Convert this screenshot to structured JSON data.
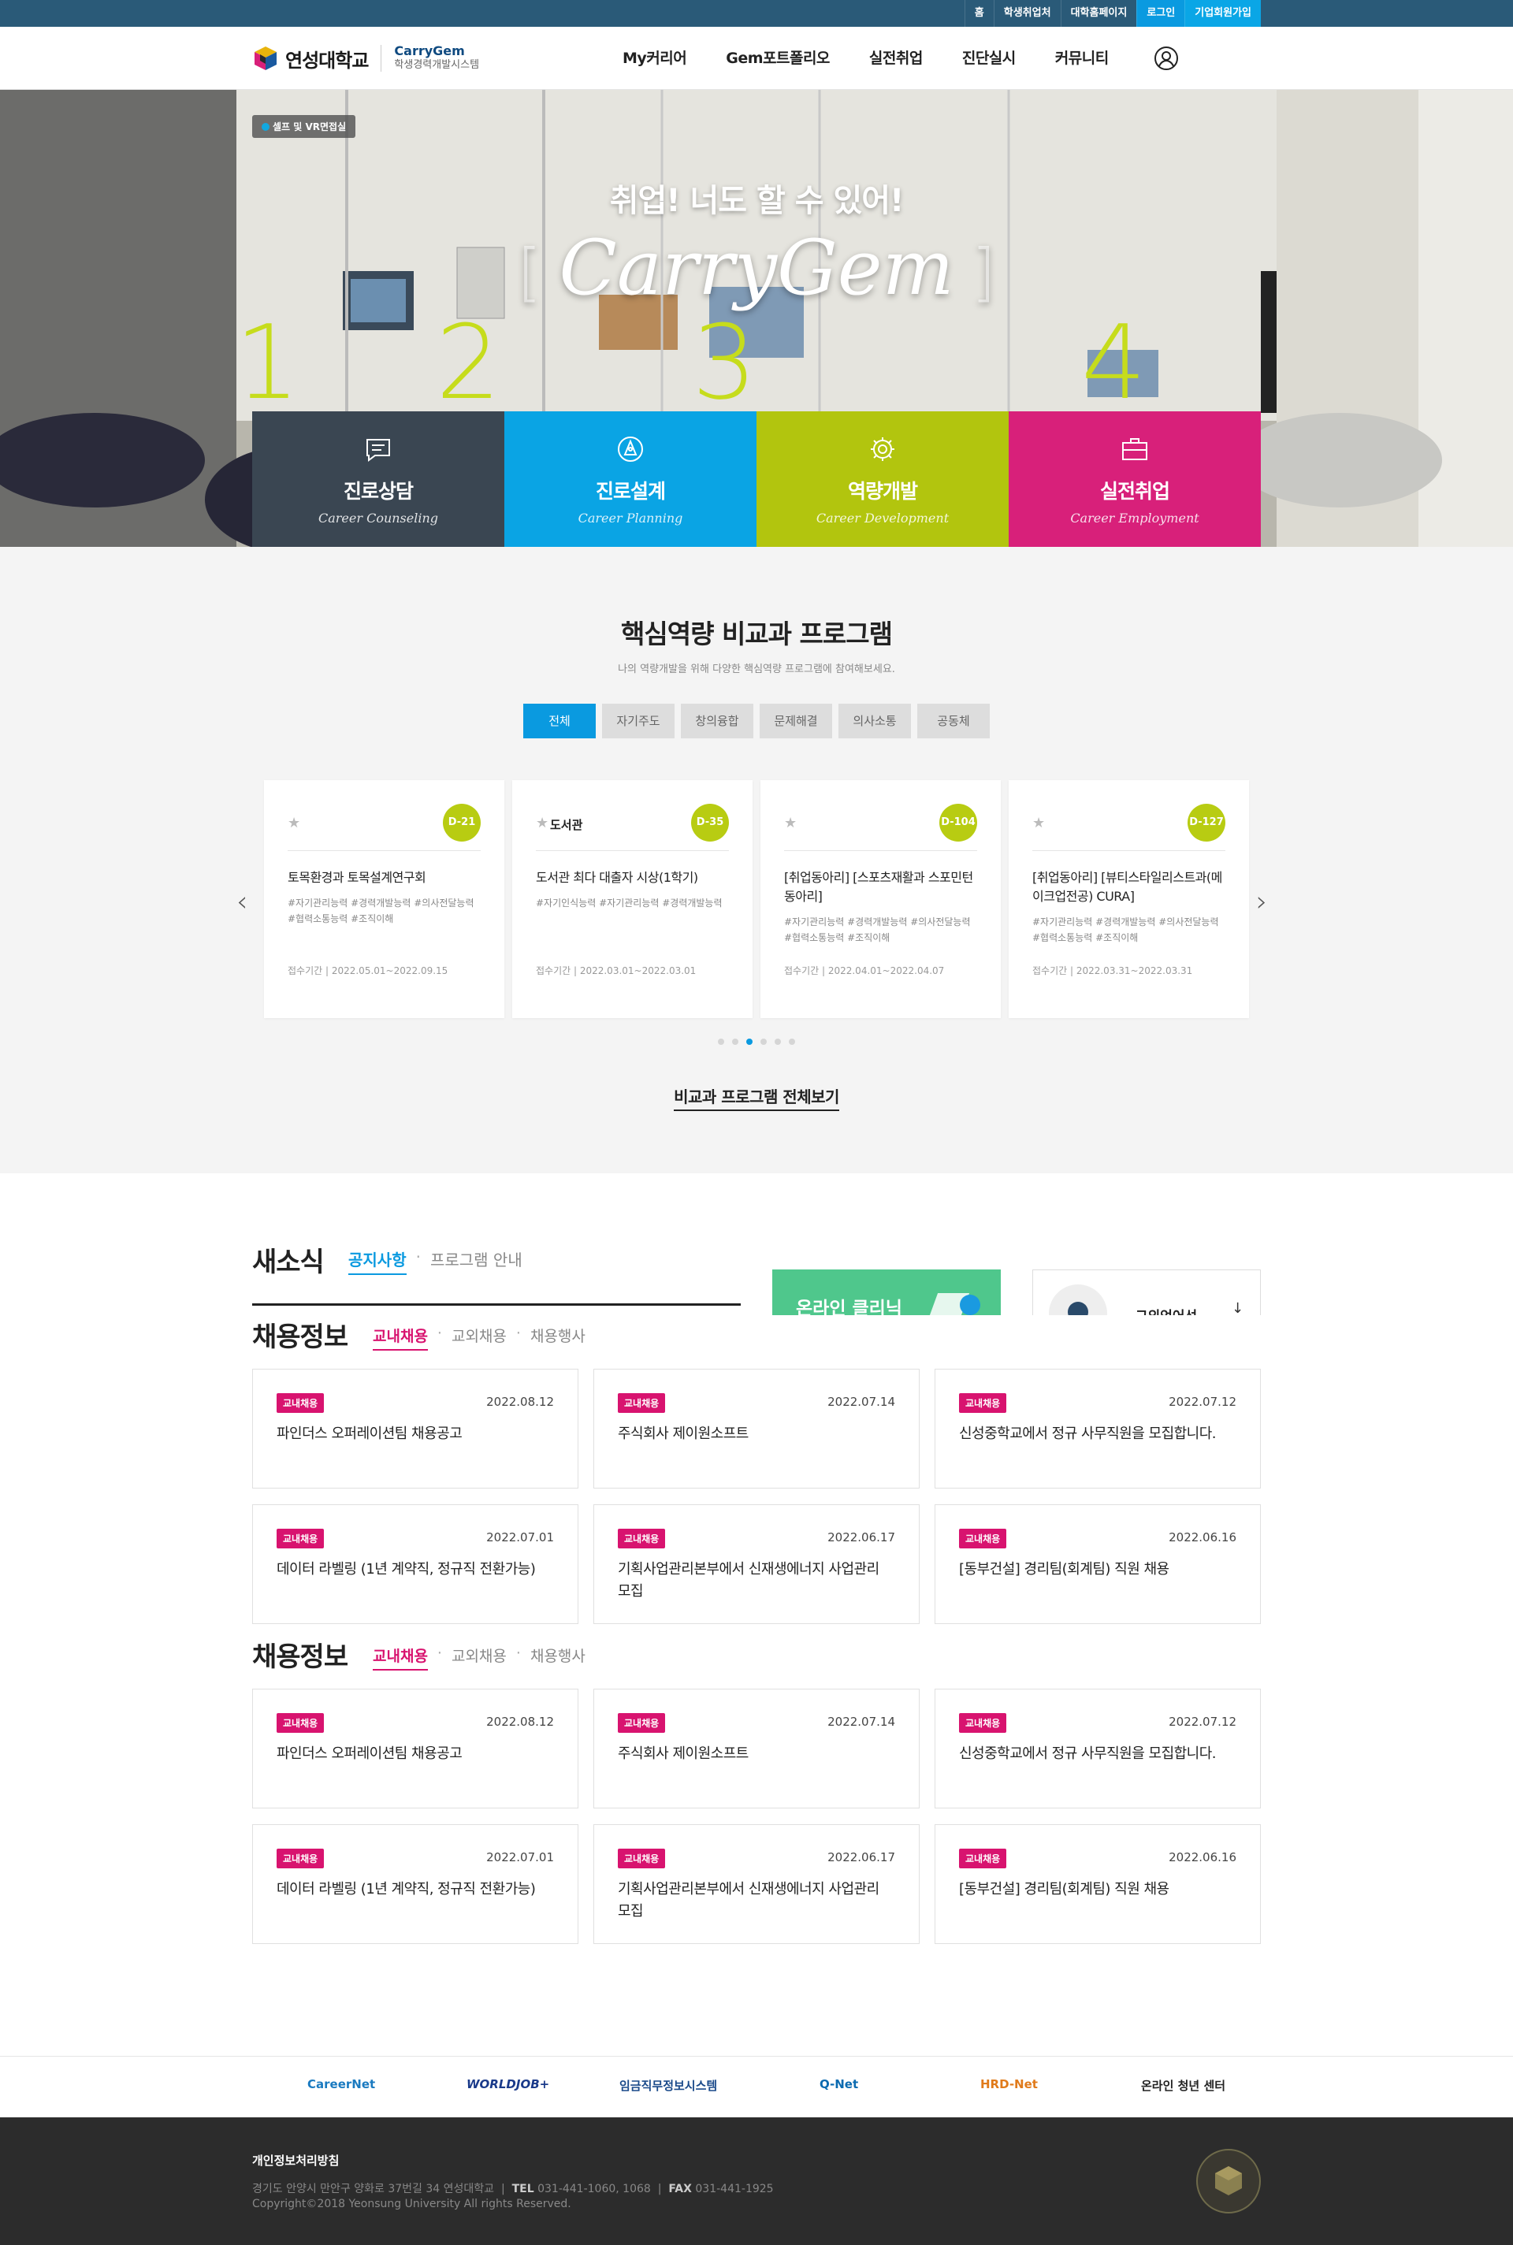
{
  "util_nav": [
    "홈",
    "학생취업처",
    "대학홈페이지",
    "로그인",
    "기업회원가입"
  ],
  "header": {
    "logo_name": "연성대학교",
    "system_name": "CarryGem",
    "system_desc": "학생경력개발시스템",
    "menu": [
      "My커리어",
      "Gem포트폴리오",
      "실전취업",
      "진단실시",
      "커뮤니티"
    ]
  },
  "hero": {
    "tag": "셀프 및 VR면접실",
    "title": "취업! 너도 할 수 있어!",
    "brand": "CarryGem",
    "bracket_left": "[",
    "bracket_right": "]",
    "numbers": [
      "1",
      "2",
      "3",
      "4"
    ],
    "cards": [
      {
        "kor": "진로상담",
        "eng": "Career Counseling",
        "color": "#3a4652",
        "icon": "chat-icon"
      },
      {
        "kor": "진로설계",
        "eng": "Career Planning",
        "color": "#0aa4e4",
        "icon": "compass-icon"
      },
      {
        "kor": "역량개발",
        "eng": "Career Development",
        "color": "#b2c50e",
        "icon": "gear-icon"
      },
      {
        "kor": "실전취업",
        "eng": "Career Employment",
        "color": "#d8207a",
        "icon": "briefcase-icon"
      }
    ]
  },
  "core": {
    "title": "핵심역량 비교과 프로그램",
    "desc": "나의 역량개발을 위해 다양한 핵심역량 프로그램에 참여해보세요.",
    "tabs": [
      "전체",
      "자기주도",
      "창의융합",
      "문제해결",
      "의사소통",
      "공동체"
    ],
    "cards": [
      {
        "category": "",
        "dday": "D-21",
        "title": "토목환경과 토목설계연구회",
        "tags": "#자기관리능력 #경력개발능력 #의사전달능력 #협력소통능력 #조직이해",
        "period": "접수기간 | 2022.05.01~2022.09.15"
      },
      {
        "category": "도서관",
        "dday": "D-35",
        "title": "도서관 최다 대출자 시상(1학기)",
        "tags": "#자기인식능력 #자기관리능력 #경력개발능력",
        "period": "접수기간 | 2022.03.01~2022.03.01"
      },
      {
        "category": "",
        "dday": "D-104",
        "title": "[취업동아리] [스포츠재활과 스포민턴 동아리]",
        "tags": "#자기관리능력 #경력개발능력 #의사전달능력 #협력소통능력 #조직이해",
        "period": "접수기간 | 2022.04.01~2022.04.07"
      },
      {
        "category": "",
        "dday": "D-127",
        "title": "[취업동아리] [뷰티스타일리스트과(메이크업전공) CURA]",
        "tags": "#자기관리능력 #경력개발능력 #의사전달능력 #협력소통능력 #조직이해",
        "period": "접수기간 | 2022.03.31~2022.03.31"
      }
    ],
    "view_all": "비교과 프로그램 전체보기"
  },
  "news": {
    "title": "새소식",
    "tabs": [
      "공지사항",
      "프로그램 안내"
    ],
    "clinic": "온라인 클리닉",
    "lang": "그외언어선"
  },
  "jobs": [
    {
      "title": "채용정보",
      "tabs": [
        "교내채용",
        "교외채용",
        "채용행사"
      ],
      "items": [
        {
          "badge": "교내채용",
          "date": "2022.08.12",
          "title": "파인더스 오퍼레이션팀 채용공고"
        },
        {
          "badge": "교내채용",
          "date": "2022.07.14",
          "title": "주식회사 제이원소프트"
        },
        {
          "badge": "교내채용",
          "date": "2022.07.12",
          "title": "신성중학교에서 정규 사무직원을 모집합니다."
        },
        {
          "badge": "교내채용",
          "date": "2022.07.01",
          "title": "데이터 라벨링 (1년 계약직, 정규직 전환가능)"
        },
        {
          "badge": "교내채용",
          "date": "2022.06.17",
          "title": "기획사업관리본부에서 신재생에너지 사업관리 모집"
        },
        {
          "badge": "교내채용",
          "date": "2022.06.16",
          "title": "[동부건설] 경리팀(회계팀) 직원 채용"
        }
      ]
    },
    {
      "title": "채용정보",
      "tabs": [
        "교내채용",
        "교외채용",
        "채용행사"
      ],
      "items": [
        {
          "badge": "교내채용",
          "date": "2022.08.12",
          "title": "파인더스 오퍼레이션팀 채용공고"
        },
        {
          "badge": "교내채용",
          "date": "2022.07.14",
          "title": "주식회사 제이원소프트"
        },
        {
          "badge": "교내채용",
          "date": "2022.07.12",
          "title": "신성중학교에서 정규 사무직원을 모집합니다."
        },
        {
          "badge": "교내채용",
          "date": "2022.07.01",
          "title": "데이터 라벨링 (1년 계약직, 정규직 전환가능)"
        },
        {
          "badge": "교내채용",
          "date": "2022.06.17",
          "title": "기획사업관리본부에서 신재생에너지 사업관리 모집"
        },
        {
          "badge": "교내채용",
          "date": "2022.06.16",
          "title": "[동부건설] 경리팀(회계팀) 직원 채용"
        }
      ]
    }
  ],
  "partners": [
    "CareerNet",
    "WORLDJOB+",
    "임금직무정보시스템",
    "Q-Net",
    "HRD-Net",
    "온라인 청년 센터"
  ],
  "footer": {
    "policy": "개인정보처리방침",
    "address": "경기도 안양시 만안구 양화로 37번길 34 연성대학교",
    "tel_label": "TEL",
    "tel": "031-441-1060, 1068",
    "fax_label": "FAX",
    "fax": "031-441-1925",
    "copyright": "Copyright©2018 Yeonsung University All rights Reserved."
  }
}
